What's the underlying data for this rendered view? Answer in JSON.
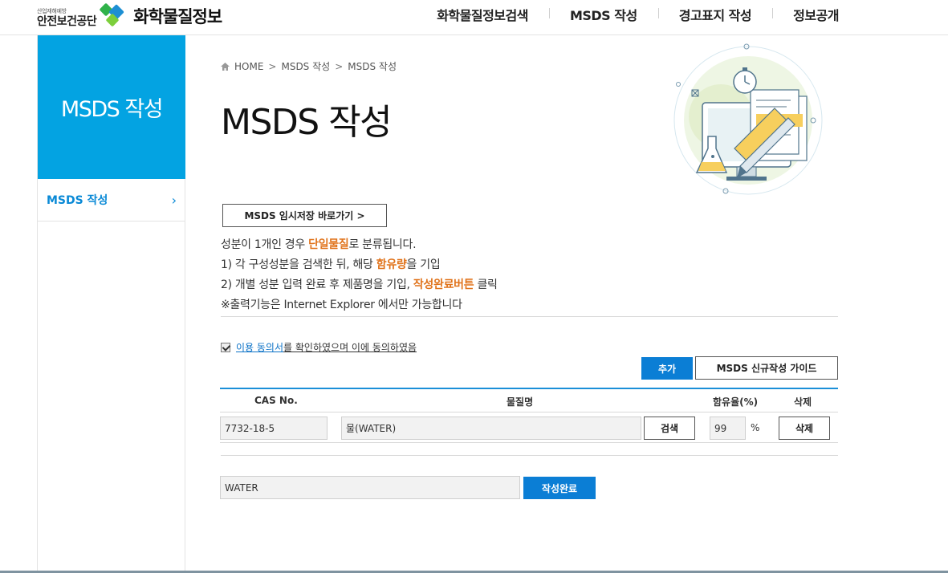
{
  "header": {
    "logo_org_small": "산업재해예방",
    "logo_org": "안전보건공단",
    "logo_site": "화학물질정보",
    "nav": [
      "화학물질정보검색",
      "MSDS 작성",
      "경고표지 작성",
      "정보공개"
    ]
  },
  "sidebar": {
    "title": "MSDS 작성",
    "items": [
      {
        "label": "MSDS 작성"
      }
    ]
  },
  "breadcrumb": [
    "HOME",
    "MSDS 작성",
    "MSDS 작성"
  ],
  "page_title": "MSDS 작성",
  "temp_save_button": "MSDS 임시저장 바로가기 >",
  "notice": {
    "line1_pre": "성분이 1개인 경우 ",
    "line1_hl": "단일물질",
    "line1_post": "로 분류됩니다.",
    "line2_pre": "1) 각 구성성분을 검색한 뒤, 해당 ",
    "line2_hl": "함유량",
    "line2_post": "을 기입",
    "line3_pre": "2) 개별 성분 입력 완료 후 제품명을 기입, ",
    "line3_hl": "작성완료버튼",
    "line3_post": " 클릭",
    "line4": "※출력기능은 Internet Explorer 에서만 가능합니다"
  },
  "agreement": {
    "checked": true,
    "link": "이용 동의서",
    "rest": "를 확인하였으며 이에 동의하였음"
  },
  "buttons": {
    "add": "추가",
    "guide": "MSDS 신규작성 가이드",
    "search": "검색",
    "delete": "삭제",
    "complete": "작성완료"
  },
  "table": {
    "headers": [
      "CAS No.",
      "물질명",
      "함유율(%)",
      "삭제"
    ],
    "rows": [
      {
        "cas": "7732-18-5",
        "name": "물(WATER)",
        "content": "99",
        "unit": "%"
      }
    ]
  },
  "product_name": "WATER",
  "colors": {
    "accent": "#03a3e2",
    "button_blue": "#0b7ed5",
    "highlight": "#e0731b"
  }
}
